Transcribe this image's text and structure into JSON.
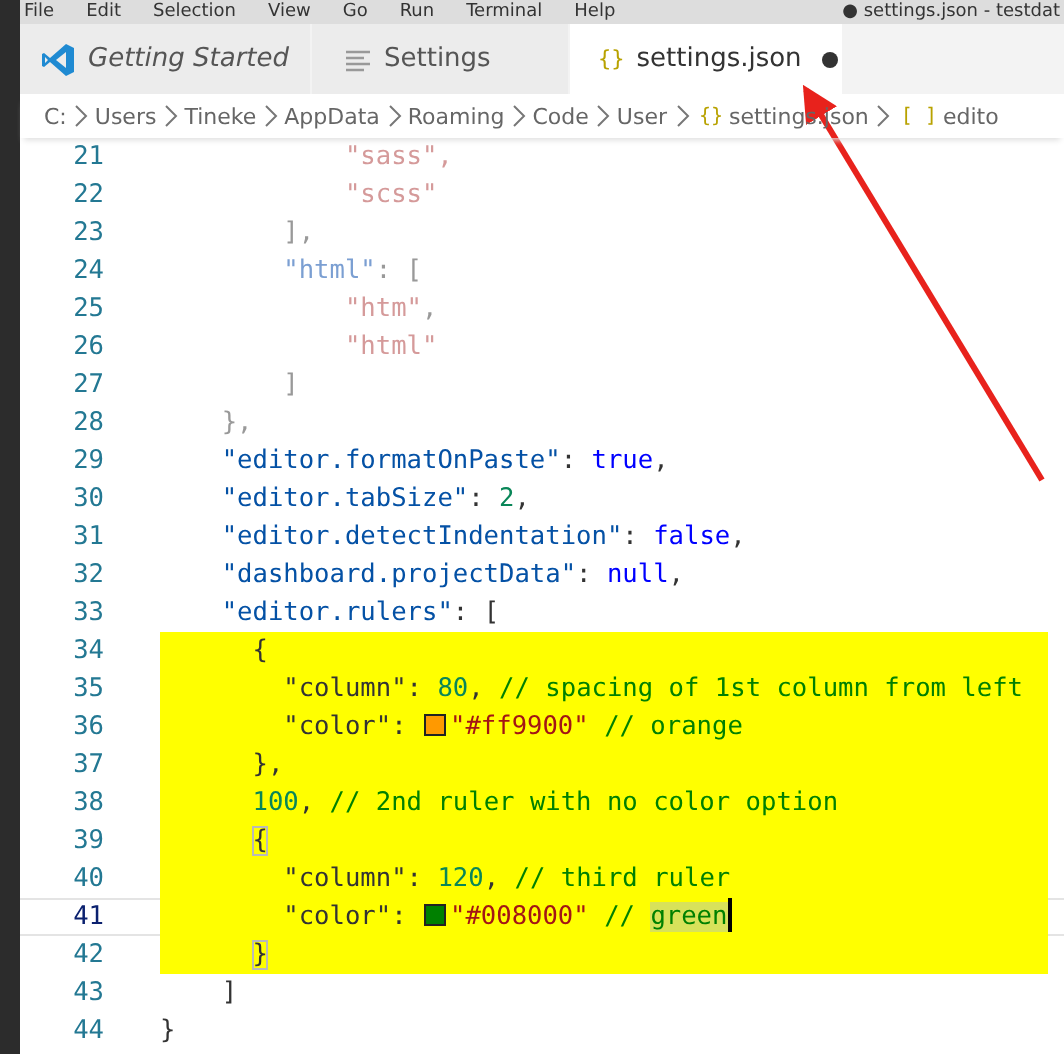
{
  "menu_bar": {
    "items": [
      "File",
      "Edit",
      "Selection",
      "View",
      "Go",
      "Run",
      "Terminal",
      "Help"
    ],
    "title": "● settings.json - testdat"
  },
  "tabs": [
    {
      "label": "Getting Started",
      "kind": "app",
      "preview": true,
      "selected": false,
      "dirty": false
    },
    {
      "label": "Settings",
      "kind": "settings",
      "preview": false,
      "selected": false,
      "dirty": false
    },
    {
      "label": "settings.json",
      "kind": "file",
      "glyph": "{}",
      "preview": false,
      "selected": true,
      "dirty": true
    }
  ],
  "breadcrumb": [
    {
      "label": "C:"
    },
    {
      "label": "Users"
    },
    {
      "label": "Tineke"
    },
    {
      "label": "AppData"
    },
    {
      "label": "Roaming"
    },
    {
      "label": "Code"
    },
    {
      "label": "User"
    },
    {
      "glyph": "{}",
      "label": "settings.json"
    },
    {
      "glyph": "[ ]",
      "label": "edito"
    }
  ],
  "lines": [
    {
      "number": "21",
      "highlighted": false,
      "current": false,
      "tokens": [
        {
          "kind": "string-dim",
          "text": "            \"sass\","
        }
      ]
    },
    {
      "number": "22",
      "highlighted": false,
      "current": false,
      "tokens": [
        {
          "kind": "string-dim",
          "text": "            \"scss\""
        }
      ]
    },
    {
      "number": "23",
      "highlighted": false,
      "current": false,
      "tokens": [
        {
          "kind": "punct-dim",
          "text": "        ],"
        }
      ]
    },
    {
      "number": "24",
      "highlighted": false,
      "current": false,
      "tokens": [
        {
          "kind": "key-dim",
          "text": "        \"html\""
        },
        {
          "kind": "punct-dim",
          "text": ": ["
        }
      ]
    },
    {
      "number": "25",
      "highlighted": false,
      "current": false,
      "tokens": [
        {
          "kind": "string-dim",
          "text": "            \"htm\""
        },
        {
          "kind": "punct-dim",
          "text": ","
        }
      ]
    },
    {
      "number": "26",
      "highlighted": false,
      "current": false,
      "tokens": [
        {
          "kind": "string-dim",
          "text": "            \"html\""
        }
      ]
    },
    {
      "number": "27",
      "highlighted": false,
      "current": false,
      "tokens": [
        {
          "kind": "punct-dim",
          "text": "        ]"
        }
      ]
    },
    {
      "number": "28",
      "highlighted": false,
      "current": false,
      "tokens": [
        {
          "kind": "punct-dim",
          "text": "    },"
        }
      ]
    },
    {
      "number": "29",
      "highlighted": false,
      "current": false,
      "tokens": [
        {
          "kind": "key",
          "text": "    \"editor.formatOnPaste\""
        },
        {
          "kind": "punct",
          "text": ": "
        },
        {
          "kind": "keyword",
          "text": "true"
        },
        {
          "kind": "punct",
          "text": ","
        }
      ]
    },
    {
      "number": "30",
      "highlighted": false,
      "current": false,
      "tokens": [
        {
          "kind": "key",
          "text": "    \"editor.tabSize\""
        },
        {
          "kind": "punct",
          "text": ": "
        },
        {
          "kind": "number",
          "text": "2"
        },
        {
          "kind": "punct",
          "text": ","
        }
      ]
    },
    {
      "number": "31",
      "highlighted": false,
      "current": false,
      "tokens": [
        {
          "kind": "key",
          "text": "    \"editor.detectIndentation\""
        },
        {
          "kind": "punct",
          "text": ": "
        },
        {
          "kind": "keyword",
          "text": "false"
        },
        {
          "kind": "punct",
          "text": ","
        }
      ]
    },
    {
      "number": "32",
      "highlighted": false,
      "current": false,
      "tokens": [
        {
          "kind": "key",
          "text": "    \"dashboard.projectData\""
        },
        {
          "kind": "punct",
          "text": ": "
        },
        {
          "kind": "keyword",
          "text": "null"
        },
        {
          "kind": "punct",
          "text": ","
        }
      ]
    },
    {
      "number": "33",
      "highlighted": false,
      "current": false,
      "tokens": [
        {
          "kind": "key",
          "text": "    \"editor.rulers\""
        },
        {
          "kind": "punct",
          "text": ": ["
        }
      ]
    },
    {
      "number": "34",
      "highlighted": true,
      "current": false,
      "tokens": [
        {
          "kind": "punct",
          "text": "      {"
        }
      ]
    },
    {
      "number": "35",
      "highlighted": true,
      "current": false,
      "tokens": [
        {
          "kind": "key",
          "text": "        \"column\""
        },
        {
          "kind": "punct",
          "text": ": "
        },
        {
          "kind": "number",
          "text": "80"
        },
        {
          "kind": "punct",
          "text": ", "
        },
        {
          "kind": "comment",
          "text": "// spacing of 1st column from left"
        }
      ]
    },
    {
      "number": "36",
      "highlighted": true,
      "current": false,
      "tokens": [
        {
          "kind": "key",
          "text": "        \"color\""
        },
        {
          "kind": "punct",
          "text": ": "
        },
        {
          "kind": "swatch",
          "color": "#ff9900"
        },
        {
          "kind": "value",
          "text": "\"#ff9900\""
        },
        {
          "kind": "comment",
          "text": " // orange"
        }
      ]
    },
    {
      "number": "37",
      "highlighted": true,
      "current": false,
      "tokens": [
        {
          "kind": "punct",
          "text": "      },"
        }
      ]
    },
    {
      "number": "38",
      "highlighted": true,
      "current": false,
      "tokens": [
        {
          "kind": "number",
          "text": "      100"
        },
        {
          "kind": "punct",
          "text": ", "
        },
        {
          "kind": "comment",
          "text": "// 2nd ruler with no color option"
        }
      ]
    },
    {
      "number": "39",
      "highlighted": true,
      "current": false,
      "tokens": [
        {
          "kind": "bracket",
          "text": "      {"
        }
      ]
    },
    {
      "number": "40",
      "highlighted": true,
      "current": false,
      "tokens": [
        {
          "kind": "key",
          "text": "        \"column\""
        },
        {
          "kind": "punct",
          "text": ": "
        },
        {
          "kind": "number",
          "text": "120"
        },
        {
          "kind": "punct",
          "text": ", "
        },
        {
          "kind": "comment",
          "text": "// third ruler"
        }
      ]
    },
    {
      "number": "41",
      "highlighted": true,
      "current": true,
      "tokens": [
        {
          "kind": "key",
          "text": "        \"color\""
        },
        {
          "kind": "punct",
          "text": ": "
        },
        {
          "kind": "swatch",
          "color": "#008000"
        },
        {
          "kind": "value",
          "text": "\"#008000\""
        },
        {
          "kind": "comment",
          "text": " // "
        },
        {
          "kind": "comment-match",
          "text": "green"
        },
        {
          "kind": "cursor"
        }
      ]
    },
    {
      "number": "42",
      "highlighted": true,
      "current": false,
      "tokens": [
        {
          "kind": "bracket",
          "text": "      }"
        }
      ]
    },
    {
      "number": "43",
      "highlighted": false,
      "current": false,
      "tokens": [
        {
          "kind": "punct",
          "text": "    ]"
        }
      ]
    },
    {
      "number": "44",
      "highlighted": false,
      "current": false,
      "tokens": [
        {
          "kind": "punct",
          "text": "}"
        }
      ]
    }
  ]
}
